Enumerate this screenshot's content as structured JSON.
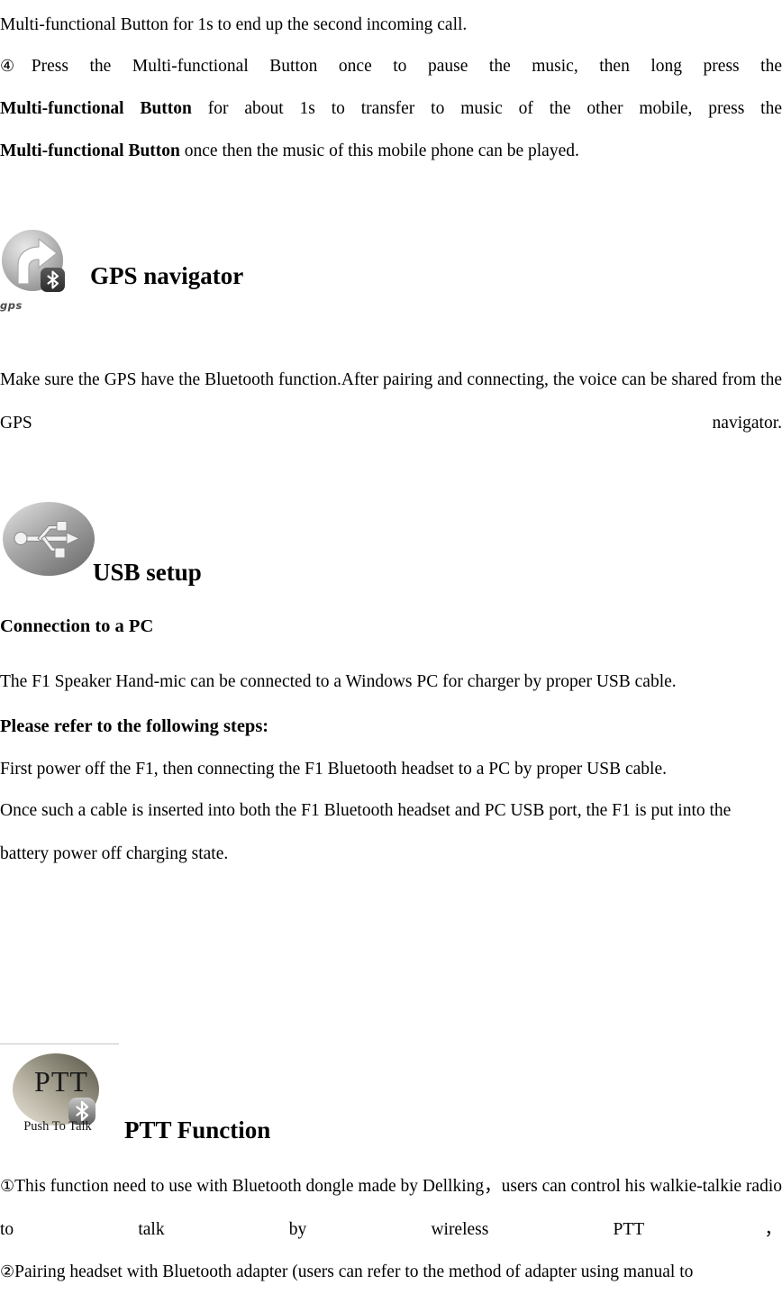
{
  "document": {
    "paragraphs": {
      "p1_continuation": "Multi-functional Button for 1s to end up the second incoming call.",
      "p2_item4_marker": "④",
      "p2_part1": "Press the Multi-functional Button once to pause the music, then long press the ",
      "p2_bold1": "Multi-functional Button",
      "p2_part2": " for about 1s to transfer to music of the other mobile, press the ",
      "p2_bold2": "Multi-functional Button",
      "p2_part3": " once then the music of this mobile phone can be played."
    },
    "gps_section": {
      "icon_name": "gps-navigator-icon",
      "icon_caption": "gps",
      "heading": "GPS navigator",
      "body": "Make sure the GPS have the Bluetooth function.After pairing and connecting, the voice can be shared from the GPS navigator."
    },
    "usb_section": {
      "icon_name": "usb-icon",
      "heading": "USB setup",
      "subheading": "Connection to a PC",
      "line1": "The F1 Speaker Hand-mic can be connected to a Windows PC for charger by proper USB cable.",
      "line2_bold": "Please refer to the following steps:",
      "line3": "First power off the F1, then connecting the F1 Bluetooth headset to a PC by proper USB cable.",
      "line4": "Once such a cable is inserted into both the F1 Bluetooth headset and PC USB port, the F1 is put into the battery power off charging state."
    },
    "ptt_section": {
      "icon_name": "ptt-icon",
      "icon_letters": "PTT",
      "icon_caption": "Push To Talk",
      "heading": "PTT Function",
      "item1_marker": "①",
      "item1_text": "This function need to use with Bluetooth dongle made by Dellking，users can control his walkie-talkie radio to talk by wireless PTT，",
      "item2_marker": "②",
      "item2_text": "Pairing headset with Bluetooth adapter (users can refer to the method of adapter using manual to"
    },
    "colors": {
      "text": "#000000",
      "divider": "#c6c6c6",
      "icon_gray_light": "#dcdcdc",
      "icon_gray_dark": "#6b6b6b",
      "ptt_olive": "#8a8670",
      "gps_caption": "#4a4a4a"
    }
  }
}
